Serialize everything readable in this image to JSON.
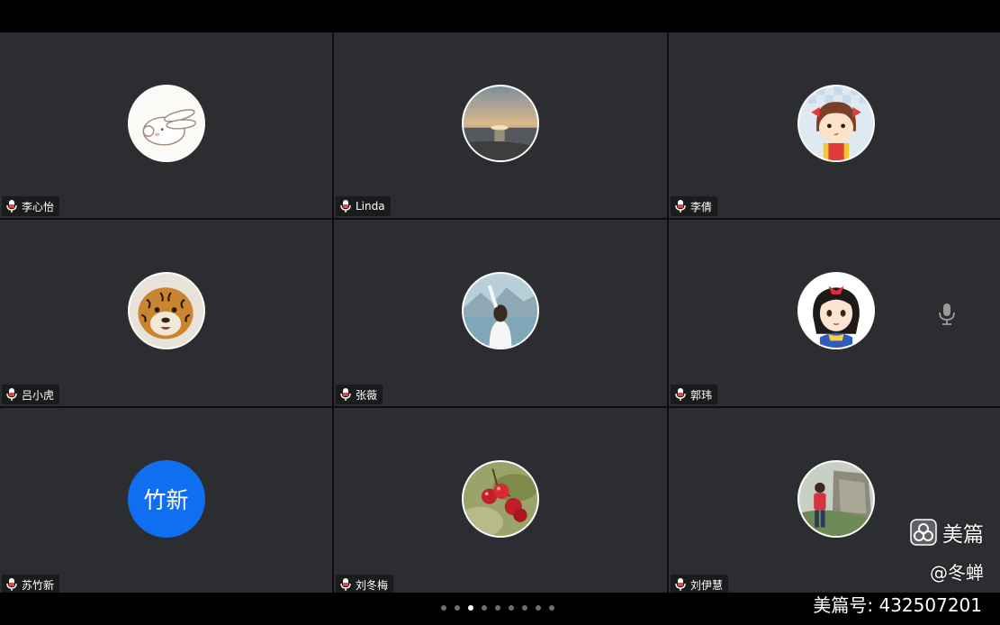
{
  "participants": [
    {
      "name": "李心怡",
      "avatar": "rabbit-avatar"
    },
    {
      "name": "Linda",
      "avatar": "sunset-avatar"
    },
    {
      "name": "李倩",
      "avatar": "cartoon-girl-avatar"
    },
    {
      "name": "吕小虎",
      "avatar": "tiger-avatar"
    },
    {
      "name": "张薇",
      "avatar": "girl-back-avatar"
    },
    {
      "name": "郭玮",
      "avatar": "snow-white-avatar"
    },
    {
      "name": "苏竹新",
      "avatar_text": "竹新"
    },
    {
      "name": "刘冬梅",
      "avatar": "cherry-avatar"
    },
    {
      "name": "刘伊慧",
      "avatar": "person-outdoor-avatar"
    }
  ],
  "pager": {
    "count": 9,
    "active": 2
  },
  "watermark": {
    "brand": "美篇",
    "author": "@冬蝉",
    "id": "美篇号: 432507201"
  },
  "colors": {
    "tile": "#2b2d30",
    "text_avatar": "#0f6ff0",
    "mic_red": "#e04646"
  }
}
